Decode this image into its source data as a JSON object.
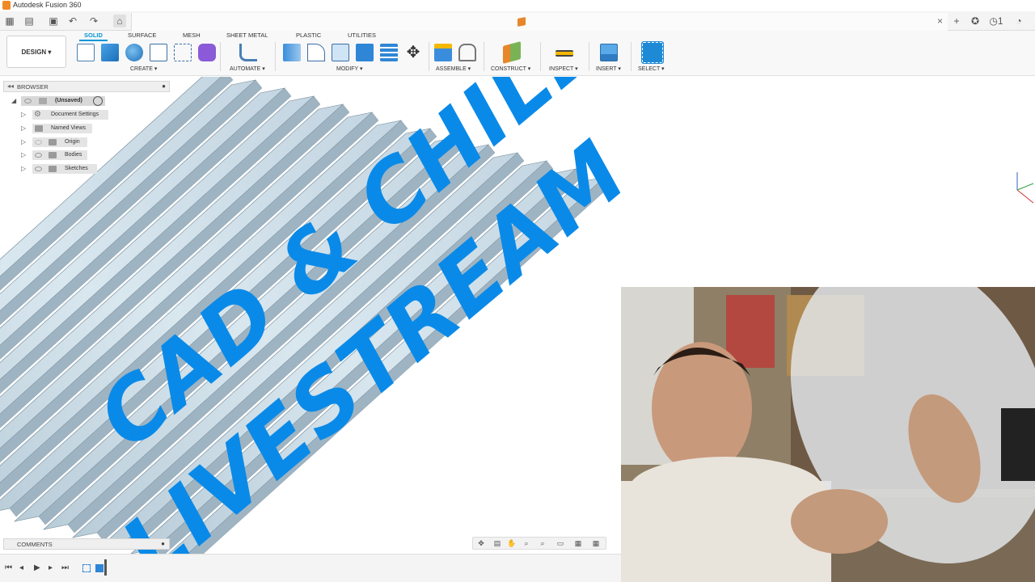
{
  "window": {
    "title": "Autodesk Fusion 360"
  },
  "workspace": {
    "label": "DESIGN ▾"
  },
  "tabs": [
    "SOLID",
    "SURFACE",
    "MESH",
    "SHEET METAL",
    "PLASTIC",
    "UTILITIES"
  ],
  "active_tab": "SOLID",
  "groups": {
    "create": "CREATE ▾",
    "automate": "AUTOMATE ▾",
    "modify": "MODIFY ▾",
    "assemble": "ASSEMBLE ▾",
    "construct": "CONSTRUCT ▾",
    "inspect": "INSPECT ▾",
    "insert": "INSERT ▾",
    "select": "SELECT ▾"
  },
  "browser": {
    "title": "BROWSER",
    "items": [
      {
        "label": "(Unsaved)",
        "icon": "document-icon"
      },
      {
        "label": "Document Settings",
        "icon": "gear-icon"
      },
      {
        "label": "Named Views",
        "icon": "folder-icon"
      },
      {
        "label": "Origin",
        "icon": "folder-icon"
      },
      {
        "label": "Bodies",
        "icon": "folder-icon"
      },
      {
        "label": "Sketches",
        "icon": "folder-icon"
      }
    ]
  },
  "comments": {
    "title": "COMMENTS"
  },
  "overlay": {
    "line1": "CAD & CHILL",
    "line2": "LIVESTREAM"
  },
  "colors": {
    "accent": "#0696d7",
    "overlay_text": "#0a8ae8",
    "bar_fill": "#c9dbe6"
  }
}
